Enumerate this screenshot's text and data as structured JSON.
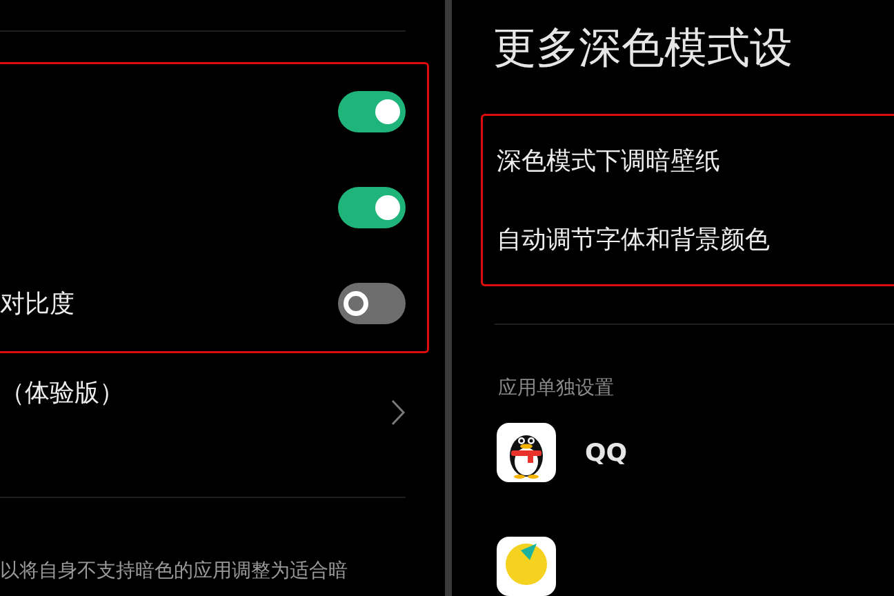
{
  "left_panel": {
    "highlighted_toggles": [
      {
        "on": true
      },
      {
        "on": true
      },
      {
        "label": "对比度",
        "on": false
      }
    ],
    "nav_row": {
      "label": "（体验版）"
    },
    "description": "以将自身不支持暗色的应用调整为适合暗"
  },
  "right_panel": {
    "title": "更多深色模式设",
    "highlighted_rows": [
      {
        "label": "深色模式下调暗壁纸"
      },
      {
        "label": "自动调节字体和背景颜色"
      }
    ],
    "section_header": "应用单独设置",
    "apps": [
      {
        "kind": "qq",
        "name": "QQ"
      },
      {
        "kind": "partial"
      }
    ]
  }
}
